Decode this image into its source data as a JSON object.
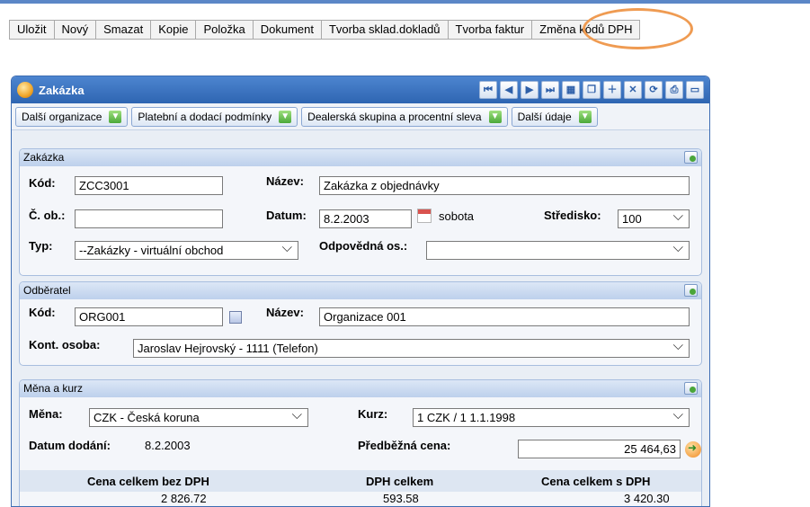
{
  "toolbar": {
    "buttons": [
      "Uložit",
      "Nový",
      "Smazat",
      "Kopie",
      "Položka",
      "Dokument",
      "Tvorba sklad.dokladů",
      "Tvorba faktur",
      "Změna kódů DPH"
    ],
    "highlight_color": "#ef9b52"
  },
  "window": {
    "title": "Zakázka",
    "title_icons": [
      "first-icon",
      "prev-icon",
      "next-icon",
      "last-icon",
      "grid-icon",
      "copy-icon",
      "add-icon",
      "delete-icon",
      "refresh-icon",
      "print-icon",
      "window-icon"
    ],
    "tabs": [
      "Další organizace",
      "Platební a dodací podmínky",
      "Dealerská skupina a procentní sleva",
      "Další údaje"
    ]
  },
  "zakazka": {
    "header": "Zakázka",
    "kod_label": "Kód:",
    "kod_value": "ZCC3001",
    "nazev_label": "Název:",
    "nazev_value": "Zakázka z objednávky",
    "cob_label": "Č. ob.:",
    "cob_value": "",
    "datum_label": "Datum:",
    "datum_value": "8.2.2003",
    "day_name": "sobota",
    "stredisko_label": "Středisko:",
    "stredisko_value": "100",
    "typ_label": "Typ:",
    "typ_value": "--Zakázky - virtuální obchod",
    "odpovedna_label": "Odpovědná os.:",
    "odpovedna_value": ""
  },
  "odberatel": {
    "header": "Odběratel",
    "kod_label": "Kód:",
    "kod_value": "ORG001",
    "nazev_label": "Název:",
    "nazev_value": "Organizace 001",
    "osoba_label": "Kont. osoba:",
    "osoba_value": "Jaroslav Hejrovský - 1111 (Telefon)"
  },
  "mena": {
    "header": "Měna a kurz",
    "mena_label": "Měna:",
    "mena_value": "CZK - Česká koruna",
    "kurz_label": "Kurz:",
    "kurz_value": "1 CZK / 1 1.1.1998",
    "datum_dodani_label": "Datum dodání:",
    "datum_dodani_value": "8.2.2003",
    "predbezna_label": "Předběžná cena:",
    "predbezna_value": "25 464,63",
    "totals": {
      "bez_dph_label": "Cena celkem bez DPH",
      "dph_label": "DPH celkem",
      "s_dph_label": "Cena celkem s DPH",
      "bez_dph_value": "2 826.72",
      "dph_value": "593.58",
      "s_dph_value": "3 420.30"
    }
  }
}
